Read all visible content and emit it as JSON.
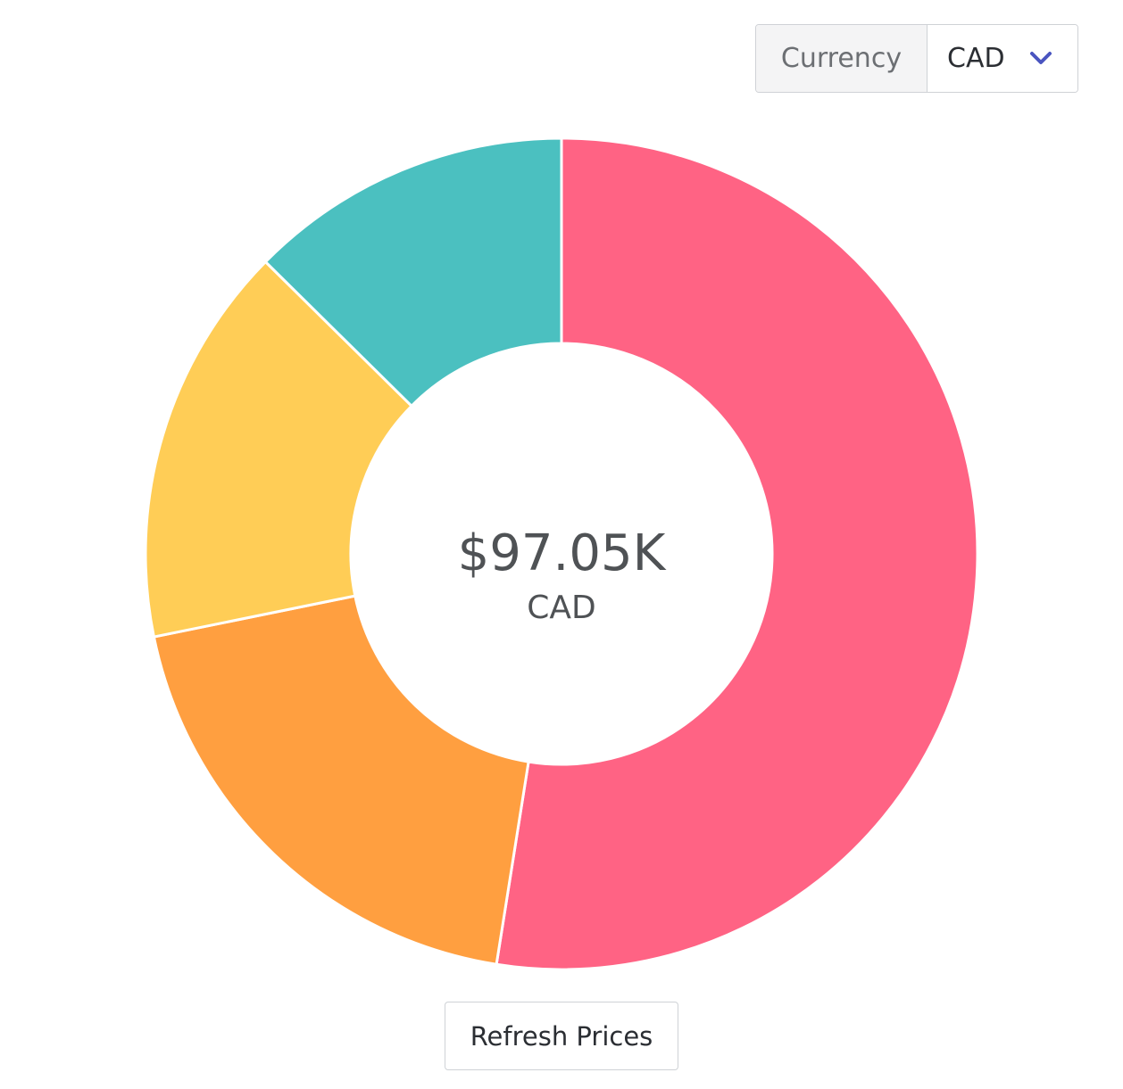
{
  "currency": {
    "label": "Currency",
    "selected": "CAD"
  },
  "center": {
    "total": "$97.05K",
    "currency": "CAD"
  },
  "refresh_label": "Refresh Prices",
  "chart_data": {
    "type": "pie",
    "values": [
      52.5,
      19.3,
      15.6,
      12.6
    ],
    "colors": [
      "#ff6384",
      "#ff9f40",
      "#ffcd56",
      "#4bc0c0"
    ],
    "donut": true
  }
}
